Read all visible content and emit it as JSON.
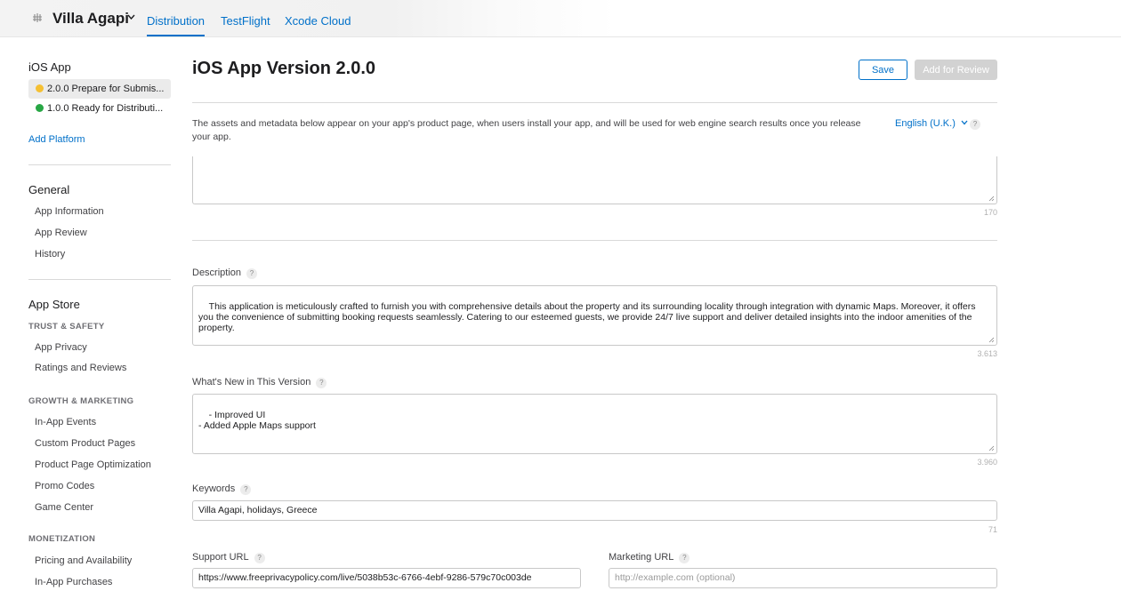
{
  "app": {
    "name": "Villa Agapi",
    "tabs": [
      {
        "label": "Distribution"
      },
      {
        "label": "TestFlight"
      },
      {
        "label": "Xcode Cloud"
      }
    ]
  },
  "sidebar": {
    "ios_header": "iOS App",
    "versions": [
      {
        "label": "2.0.0 Prepare for Submis...",
        "status_color": "#f5c033"
      },
      {
        "label": "1.0.0 Ready for Distributi...",
        "status_color": "#28a745"
      }
    ],
    "add_platform": "Add Platform",
    "general": {
      "header": "General",
      "items": [
        "App Information",
        "App Review",
        "History"
      ]
    },
    "app_store": {
      "header": "App Store",
      "trust_safety": {
        "label": "TRUST & SAFETY",
        "items": [
          "App Privacy",
          "Ratings and Reviews"
        ]
      },
      "growth": {
        "label": "GROWTH & MARKETING",
        "items": [
          "In-App Events",
          "Custom Product Pages",
          "Product Page Optimization",
          "Promo Codes",
          "Game Center"
        ]
      },
      "monetization": {
        "label": "MONETIZATION",
        "items": [
          "Pricing and Availability",
          "In-App Purchases"
        ]
      }
    }
  },
  "main": {
    "title": "iOS App Version 2.0.0",
    "save_label": "Save",
    "review_label": "Add for Review",
    "intro": "The assets and metadata below appear on your app's product page, when users install your app, and will be used for web engine search results once you release your app.",
    "language": "English (U.K.)",
    "help_glyph": "?",
    "promo_counter": "170",
    "description": {
      "label": "Description",
      "value": "This application is meticulously crafted to furnish you with comprehensive details about the property and its surrounding locality through integration with dynamic Maps. Moreover, it offers you the convenience of submitting booking requests seamlessly. Catering to our esteemed guests, we provide 24/7 live support and deliver detailed insights into the indoor amenities of the property.",
      "counter": "3.613"
    },
    "whats_new": {
      "label": "What's New in This Version",
      "value": "- Improved UI\n- Added Apple Maps support",
      "counter": "3.960"
    },
    "keywords": {
      "label": "Keywords",
      "value": "Villa Agapi, holidays, Greece",
      "counter": "71"
    },
    "support_url": {
      "label": "Support URL",
      "value": "https://www.freeprivacypolicy.com/live/5038b53c-6766-4ebf-9286-579c70c003de"
    },
    "marketing_url": {
      "label": "Marketing URL",
      "placeholder": "http://example.com (optional)"
    }
  },
  "colors": {
    "accent": "#0070c9",
    "status_prepare": "#f5c033",
    "status_ready": "#28a745"
  }
}
